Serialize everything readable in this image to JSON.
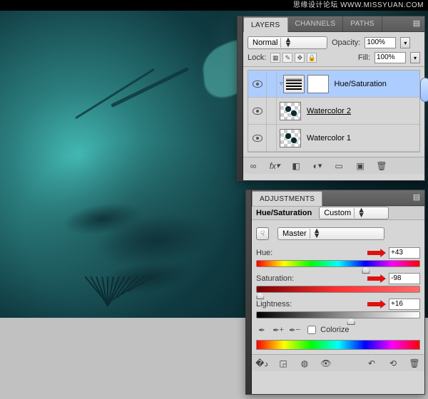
{
  "watermark": "思缘设计论坛  WWW.MISSYUAN.COM",
  "layers_panel": {
    "tabs": [
      "LAYERS",
      "CHANNELS",
      "PATHS"
    ],
    "active_tab": 0,
    "blend_mode": "Normal",
    "opacity_label": "Opacity:",
    "opacity_value": "100%",
    "lock_label": "Lock:",
    "fill_label": "Fill:",
    "fill_value": "100%",
    "layers": [
      {
        "name": "Hue/Saturation",
        "visible": true,
        "selected": true,
        "kind": "adj"
      },
      {
        "name": "Watercolor 2",
        "visible": true,
        "selected": false,
        "kind": "px",
        "underlined": true
      },
      {
        "name": "Watercolor 1",
        "visible": true,
        "selected": false,
        "kind": "px"
      }
    ],
    "footer_icons": [
      "link",
      "fx",
      "mask",
      "fill-adj",
      "group",
      "new",
      "trash"
    ]
  },
  "adjustments_panel": {
    "title": "ADJUSTMENTS",
    "type_label": "Hue/Saturation",
    "preset": "Custom",
    "range": "Master",
    "hue": {
      "label": "Hue:",
      "value": "+43",
      "pos": 67
    },
    "saturation": {
      "label": "Saturation:",
      "value": "-98",
      "pos": 2
    },
    "lightness": {
      "label": "Lightness:",
      "value": "+16",
      "pos": 58
    },
    "colorize_label": "Colorize",
    "colorize_checked": false,
    "footer_icons": [
      "back",
      "grid",
      "clip",
      "eye",
      "prev",
      "reset",
      "trash"
    ]
  }
}
